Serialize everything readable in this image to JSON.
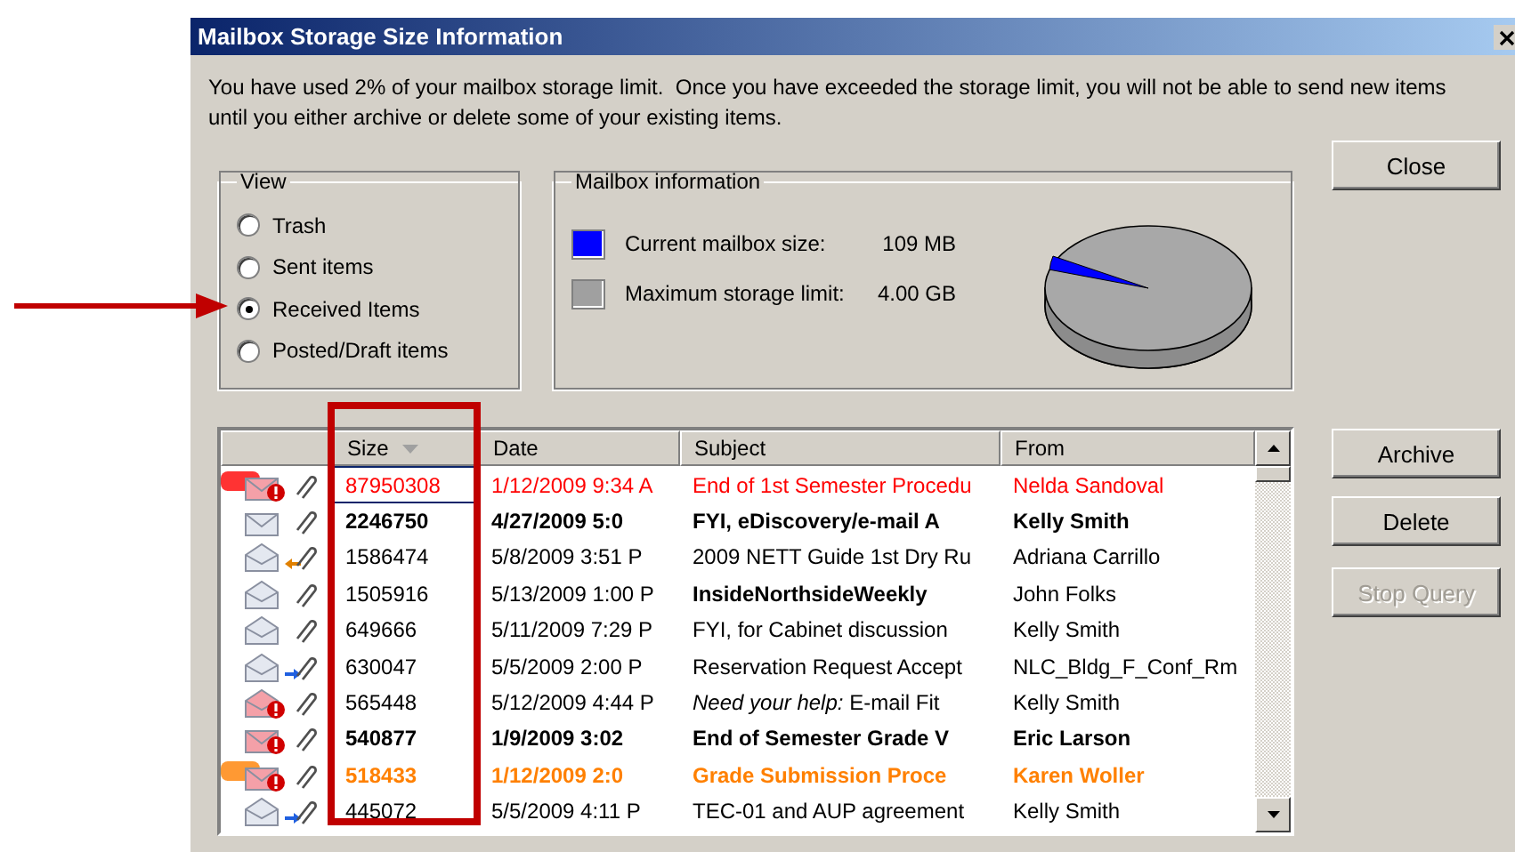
{
  "window": {
    "title": "Mailbox Storage Size Information"
  },
  "message": "You have used 2% of your mailbox storage limit.  Once you have exceeded the storage limit, you will not be able to send new items until you either archive or delete some of your existing items.",
  "view": {
    "label": "View",
    "options": [
      {
        "label": "Trash",
        "selected": false
      },
      {
        "label": "Sent items",
        "selected": false
      },
      {
        "label": "Received Items",
        "selected": true
      },
      {
        "label": "Posted/Draft items",
        "selected": false
      }
    ]
  },
  "mailbox_info": {
    "label": "Mailbox information",
    "legend": [
      {
        "label": "Current mailbox size:",
        "value": "109 MB",
        "color": "#0000ff"
      },
      {
        "label": "Maximum storage limit:",
        "value": "4.00 GB",
        "color": "#a0a0a0"
      }
    ]
  },
  "table": {
    "columns": [
      {
        "label": "Size",
        "sorted": true
      },
      {
        "label": "Date",
        "sorted": false
      },
      {
        "label": "Subject",
        "sorted": false
      },
      {
        "label": "From",
        "sorted": false
      }
    ],
    "rows": [
      {
        "kind": "unread",
        "urgent": true,
        "attachment": true,
        "tagged": true,
        "color": "#ff0000",
        "unread": false,
        "focused": true,
        "size": "87950308",
        "date": "1/12/2009 9:34 A",
        "subject": "End of 1st Semester Procedu",
        "from": "Nelda Sandoval"
      },
      {
        "kind": "unread",
        "urgent": false,
        "attachment": true,
        "tagged": false,
        "color": "#000000",
        "unread": true,
        "focused": false,
        "size": "2246750",
        "date": "4/27/2009 5:0",
        "subject": "FYI, eDiscovery/e-mail A",
        "from": "Kelly Smith"
      },
      {
        "kind": "replied",
        "urgent": false,
        "attachment": true,
        "tagged": false,
        "color": "#000000",
        "unread": false,
        "focused": false,
        "size": "1586474",
        "date": "5/8/2009 3:51 P",
        "subject": "2009 NETT Guide 1st Dry Ru",
        "from": "Adriana Carrillo"
      },
      {
        "kind": "read",
        "urgent": false,
        "attachment": true,
        "tagged": false,
        "color": "#000000",
        "unread": false,
        "focused": false,
        "size": "1505916",
        "date": "5/13/2009 1:00 P",
        "subject": "**InsideNorthsideWeekly**",
        "from": "John Folks"
      },
      {
        "kind": "read",
        "urgent": false,
        "attachment": true,
        "tagged": false,
        "color": "#000000",
        "unread": false,
        "focused": false,
        "size": "649666",
        "date": "5/11/2009 7:29 P",
        "subject": "FYI, for Cabinet discussion",
        "from": "Kelly Smith"
      },
      {
        "kind": "forwarded",
        "urgent": false,
        "attachment": true,
        "tagged": false,
        "color": "#000000",
        "unread": false,
        "focused": false,
        "size": "630047",
        "date": "5/5/2009 2:00 P",
        "subject": "Reservation Request Accept",
        "from": "NLC_Bldg_F_Conf_Rm"
      },
      {
        "kind": "read",
        "urgent": true,
        "attachment": true,
        "tagged": false,
        "color": "#000000",
        "unread": false,
        "focused": false,
        "size": "565448",
        "date": "5/12/2009 4:44 P",
        "subject": "*Need your help:* E-mail Fit",
        "from": "Kelly Smith"
      },
      {
        "kind": "unread",
        "urgent": true,
        "attachment": true,
        "tagged": false,
        "color": "#000000",
        "unread": true,
        "focused": false,
        "size": "540877",
        "date": "1/9/2009 3:02",
        "subject": "End of Semester Grade V",
        "from": "Eric Larson"
      },
      {
        "kind": "unread",
        "urgent": true,
        "attachment": true,
        "tagged": true,
        "color": "#ff8000",
        "unread": true,
        "focused": false,
        "size": "518433",
        "date": "1/12/2009 2:0",
        "subject": "Grade Submission Proce",
        "from": "Karen Woller"
      },
      {
        "kind": "forwarded",
        "urgent": false,
        "attachment": true,
        "tagged": false,
        "color": "#000000",
        "unread": false,
        "focused": false,
        "size": "445072",
        "date": "5/5/2009 4:11 P",
        "subject": "TEC-01 and AUP agreement",
        "from": "Kelly Smith"
      }
    ]
  },
  "buttons": [
    {
      "label": "Close",
      "disabled": false
    },
    {
      "label": "Archive",
      "disabled": false
    },
    {
      "label": "Delete",
      "disabled": false
    },
    {
      "label": "Stop Query",
      "disabled": true
    }
  ]
}
